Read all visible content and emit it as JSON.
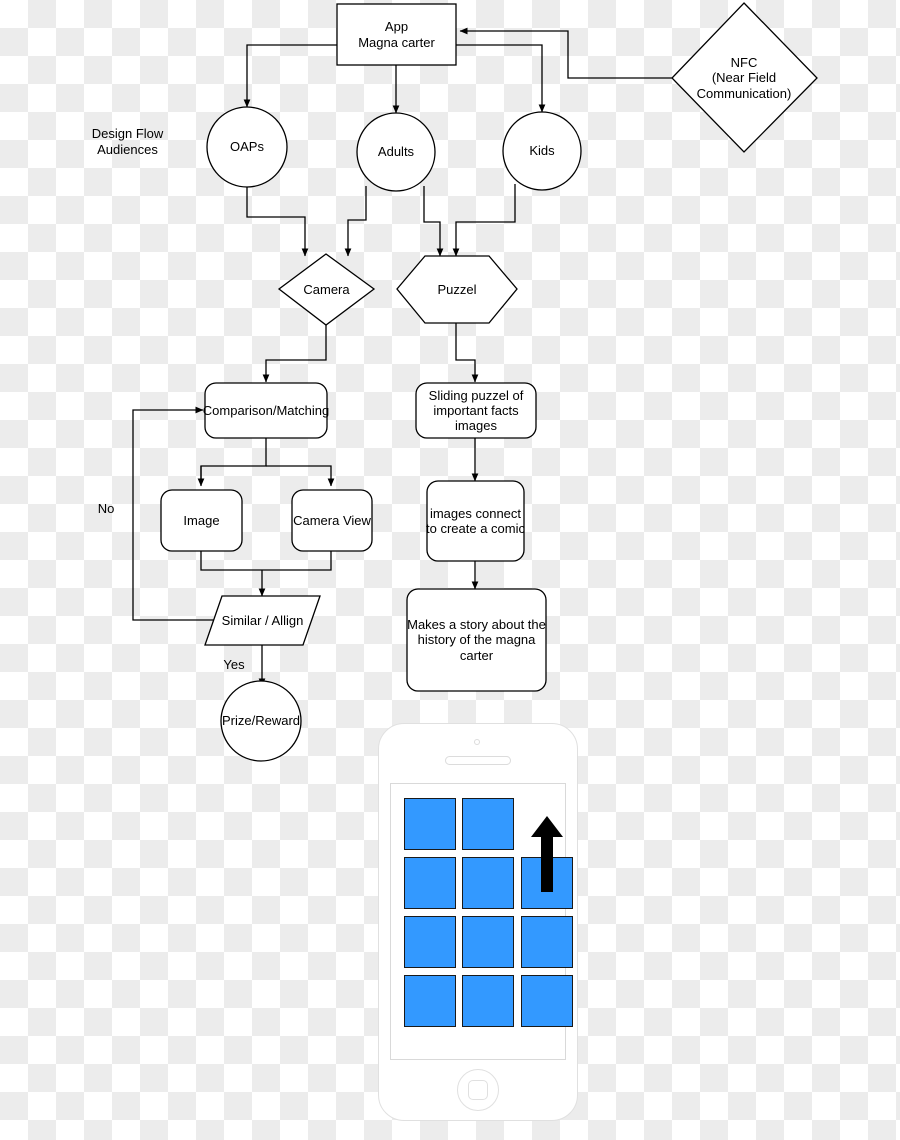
{
  "diagram": {
    "title_label": "Design Flow\nAudiences",
    "nodes": [
      {
        "id": "app",
        "label": "App\nMagna carter",
        "shape": "rect"
      },
      {
        "id": "nfc",
        "label": "NFC\n(Near Field\nCommunication)",
        "shape": "diamond"
      },
      {
        "id": "oaps",
        "label": "OAPs",
        "shape": "circle"
      },
      {
        "id": "adults",
        "label": "Adults",
        "shape": "circle"
      },
      {
        "id": "kids",
        "label": "Kids",
        "shape": "circle"
      },
      {
        "id": "camera",
        "label": "Camera",
        "shape": "diamond"
      },
      {
        "id": "puzzel",
        "label": "Puzzel",
        "shape": "hexagon"
      },
      {
        "id": "comparison",
        "label": "Comparison/Matching",
        "shape": "rounded-rect"
      },
      {
        "id": "sliding",
        "label": "Sliding puzzel of\nimportant facts\nimages",
        "shape": "rounded-rect"
      },
      {
        "id": "image",
        "label": "Image",
        "shape": "rounded-rect"
      },
      {
        "id": "cameraview",
        "label": "Camera View",
        "shape": "rounded-rect"
      },
      {
        "id": "comic",
        "label": "images connect\nto create a comic",
        "shape": "rounded-rect"
      },
      {
        "id": "similar",
        "label": "Similar / Allign",
        "shape": "parallelogram"
      },
      {
        "id": "story",
        "label": "Makes a story about the\nhistory of the magna\ncarter",
        "shape": "rounded-rect"
      },
      {
        "id": "prize",
        "label": "Prize/Reward",
        "shape": "circle"
      }
    ],
    "edge_labels": {
      "no": "No",
      "yes": "Yes"
    },
    "stroke_color": "#000000",
    "fill_color": "#ffffff"
  },
  "phone_mockup": {
    "device": "smartphone",
    "tile_color": "#3399ff",
    "body_color": "#ffffff",
    "grid_rows": 4,
    "grid_cols": 3,
    "empty_slot": "row1-col3",
    "arrow_direction": "up",
    "tiles": [
      [
        true,
        true,
        false
      ],
      [
        true,
        true,
        true
      ],
      [
        true,
        true,
        true
      ],
      [
        true,
        true,
        true
      ]
    ]
  }
}
